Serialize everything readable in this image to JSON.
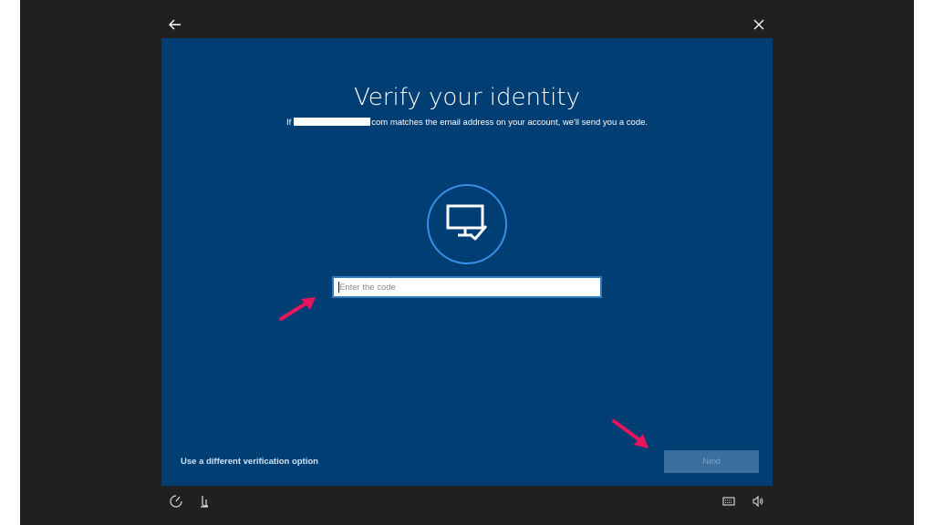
{
  "dialog": {
    "title": "Verify your identity",
    "subtitle_prefix": "If",
    "subtitle_suffix": "com matches the email address on your account, we'll send you a code.",
    "code_input": {
      "placeholder": "Enter the code",
      "value": ""
    },
    "alt_link_label": "Use a different verification option",
    "next_label": "Next"
  },
  "icons": {
    "back": "back-arrow-icon",
    "close": "close-icon",
    "device": "monitor-check-icon",
    "ease_of_access": "ease-of-access-icon",
    "accessibility": "accessibility-icon",
    "keyboard": "keyboard-icon",
    "volume": "volume-icon"
  },
  "colors": {
    "panel": "#003e73",
    "accent": "#3a8ee6",
    "annotation_arrow": "#e8155e",
    "next_disabled": "#3a6e9e"
  }
}
